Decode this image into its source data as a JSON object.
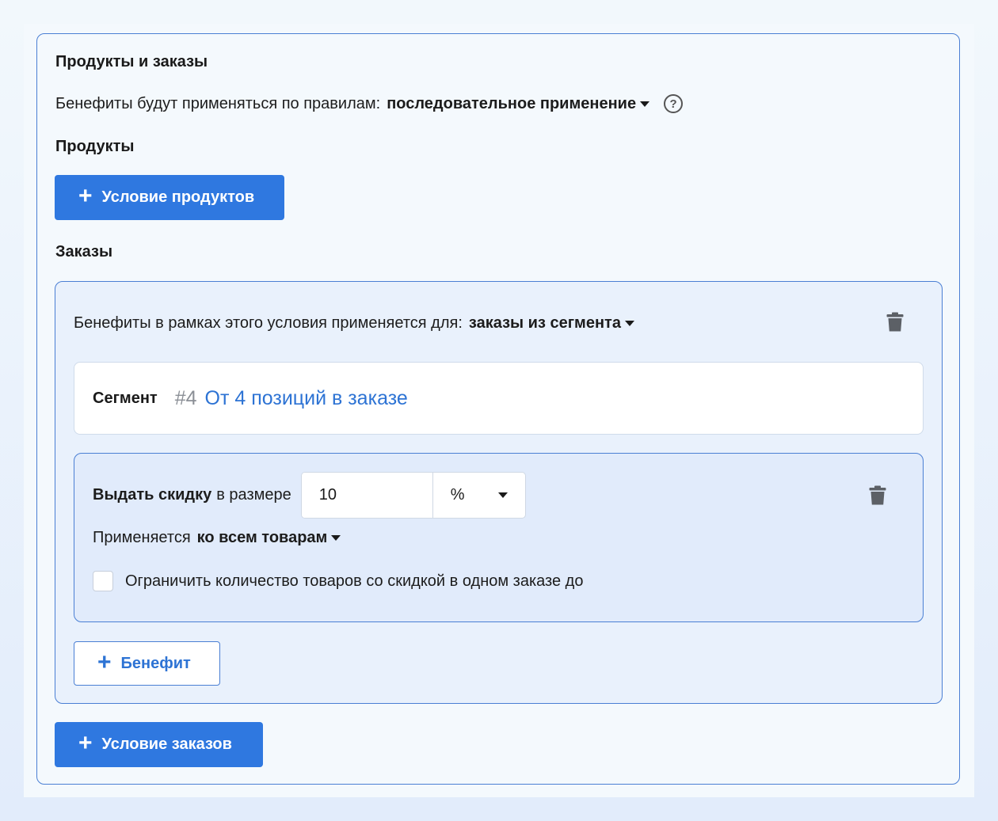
{
  "section": {
    "title": "Продукты и заказы",
    "rules_prefix": "Бенефиты будут применяться по правилам:",
    "rules_value": "последовательное применение",
    "help_glyph": "?"
  },
  "products": {
    "heading": "Продукты",
    "add_condition_label": "Условие продуктов"
  },
  "orders": {
    "heading": "Заказы",
    "condition": {
      "applies_prefix": "Бенефиты в рамках этого условия применяется для:",
      "applies_value": "заказы из сегмента",
      "segment": {
        "label": "Сегмент",
        "number": "#4",
        "name": "От 4 позиций в заказе"
      },
      "benefit": {
        "action_bold": "Выдать скидку",
        "action_rest": "в размере",
        "value": "10",
        "unit": "%",
        "applies_prefix": "Применяется",
        "applies_value": "ко всем товарам",
        "limit_label": "Ограничить количество товаров со скидкой в одном заказе до",
        "limit_checked": false
      },
      "add_benefit_label": "Бенефит"
    },
    "add_condition_label": "Условие заказов"
  },
  "icons": {
    "plus": "plus-icon",
    "trash": "trash-icon",
    "caret": "caret-down-icon",
    "help": "help-circle-icon"
  },
  "colors": {
    "primary": "#2f78e0",
    "link": "#2d73d4",
    "border": "#4a7fd4"
  }
}
